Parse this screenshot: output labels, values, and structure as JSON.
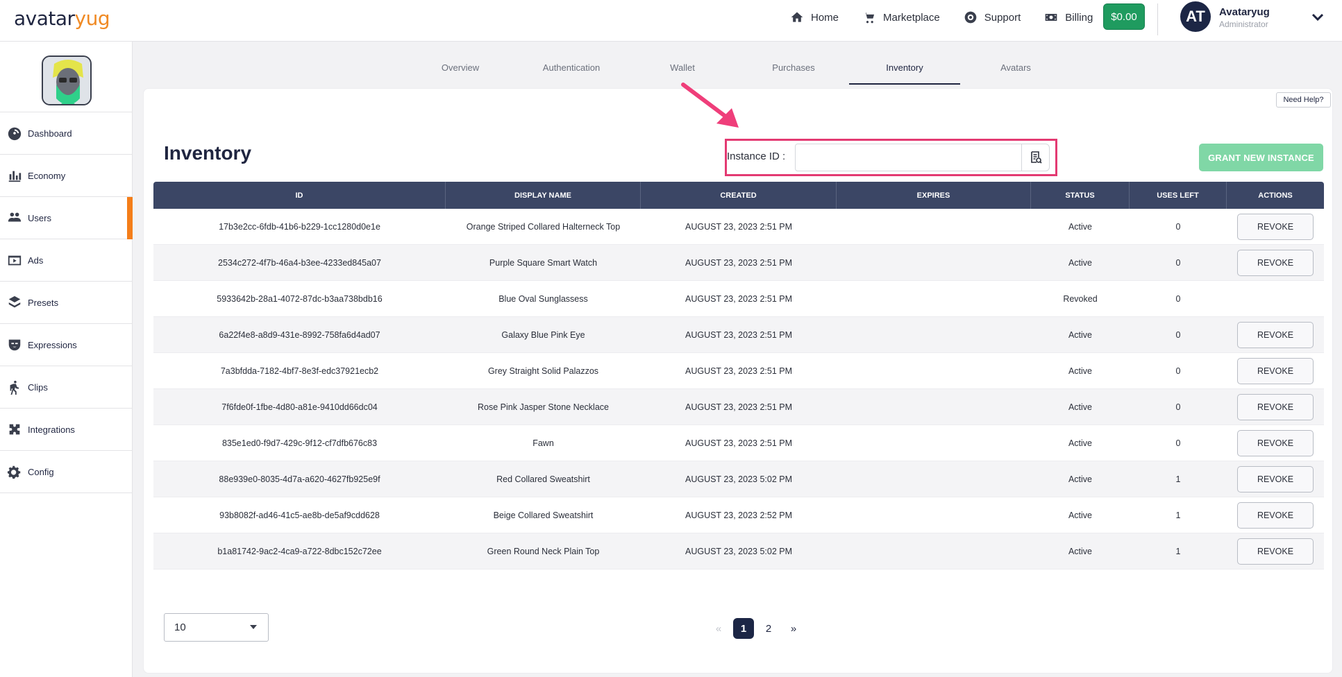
{
  "brand": {
    "logo_part1": "avatar",
    "logo_part2": "yug"
  },
  "nav": {
    "links": [
      {
        "label": "Home",
        "icon": "home-icon"
      },
      {
        "label": "Marketplace",
        "icon": "cart-icon"
      },
      {
        "label": "Support",
        "icon": "lifebuoy-icon"
      },
      {
        "label": "Billing",
        "icon": "money-icon"
      }
    ],
    "balance": "$0.00",
    "user": {
      "initials": "AT",
      "name": "Avataryug",
      "role": "Administrator"
    }
  },
  "sidebar": {
    "items": [
      {
        "label": "Dashboard",
        "icon": "gauge-icon"
      },
      {
        "label": "Economy",
        "icon": "bar-chart-icon"
      },
      {
        "label": "Users",
        "icon": "users-icon"
      },
      {
        "label": "Ads",
        "icon": "ads-icon"
      },
      {
        "label": "Presets",
        "icon": "presets-icon"
      },
      {
        "label": "Expressions",
        "icon": "mask-icon"
      },
      {
        "label": "Clips",
        "icon": "walking-icon"
      },
      {
        "label": "Integrations",
        "icon": "puzzle-icon"
      },
      {
        "label": "Config",
        "icon": "gears-icon"
      }
    ],
    "active": "Users"
  },
  "tabs": [
    "Overview",
    "Authentication",
    "Wallet",
    "Purchases",
    "Inventory",
    "Avatars"
  ],
  "active_tab": "Inventory",
  "page": {
    "title": "Inventory",
    "need_help": "Need Help?",
    "instance_label": "Instance ID :",
    "instance_value": "",
    "grant_button": "GRANT NEW INSTANCE"
  },
  "table": {
    "headers": [
      "ID",
      "DISPLAY NAME",
      "CREATED",
      "EXPIRES",
      "STATUS",
      "USES LEFT",
      "ACTIONS"
    ],
    "action_label": "REVOKE",
    "rows": [
      {
        "id": "17b3e2cc-6fdb-41b6-b229-1cc1280d0e1e",
        "name": "Orange Striped Collared Halterneck Top",
        "created": "AUGUST 23, 2023 2:51 PM",
        "expires": "",
        "status": "Active",
        "uses": "0",
        "revokable": true
      },
      {
        "id": "2534c272-4f7b-46a4-b3ee-4233ed845a07",
        "name": "Purple Square Smart Watch",
        "created": "AUGUST 23, 2023 2:51 PM",
        "expires": "",
        "status": "Active",
        "uses": "0",
        "revokable": true
      },
      {
        "id": "5933642b-28a1-4072-87dc-b3aa738bdb16",
        "name": "Blue Oval Sunglassess",
        "created": "AUGUST 23, 2023 2:51 PM",
        "expires": "",
        "status": "Revoked",
        "uses": "0",
        "revokable": false
      },
      {
        "id": "6a22f4e8-a8d9-431e-8992-758fa6d4ad07",
        "name": "Galaxy Blue Pink Eye",
        "created": "AUGUST 23, 2023 2:51 PM",
        "expires": "",
        "status": "Active",
        "uses": "0",
        "revokable": true
      },
      {
        "id": "7a3bfdda-7182-4bf7-8e3f-edc37921ecb2",
        "name": "Grey Straight Solid Palazzos",
        "created": "AUGUST 23, 2023 2:51 PM",
        "expires": "",
        "status": "Active",
        "uses": "0",
        "revokable": true
      },
      {
        "id": "7f6fde0f-1fbe-4d80-a81e-9410dd66dc04",
        "name": "Rose Pink Jasper Stone Necklace",
        "created": "AUGUST 23, 2023 2:51 PM",
        "expires": "",
        "status": "Active",
        "uses": "0",
        "revokable": true
      },
      {
        "id": "835e1ed0-f9d7-429c-9f12-cf7dfb676c83",
        "name": "Fawn",
        "created": "AUGUST 23, 2023 2:51 PM",
        "expires": "",
        "status": "Active",
        "uses": "0",
        "revokable": true
      },
      {
        "id": "88e939e0-8035-4d7a-a620-4627fb925e9f",
        "name": "Red Collared Sweatshirt",
        "created": "AUGUST 23, 2023 5:02 PM",
        "expires": "",
        "status": "Active",
        "uses": "1",
        "revokable": true
      },
      {
        "id": "93b8082f-ad46-41c5-ae8b-de5af9cdd628",
        "name": "Beige Collared Sweatshirt",
        "created": "AUGUST 23, 2023 2:52 PM",
        "expires": "",
        "status": "Active",
        "uses": "1",
        "revokable": true
      },
      {
        "id": "b1a81742-9ac2-4ca9-a722-8dbc152c72ee",
        "name": "Green Round Neck Plain Top",
        "created": "AUGUST 23, 2023 5:02 PM",
        "expires": "",
        "status": "Active",
        "uses": "1",
        "revokable": true
      }
    ]
  },
  "pagination": {
    "page_size": "10",
    "prev": "«",
    "pages": [
      "1",
      "2"
    ],
    "current": "1",
    "next": "»"
  },
  "colors": {
    "accent_orange": "#f47e1a",
    "header_navy": "#3b4665",
    "highlight_pink": "#e33a72",
    "wallet_green": "#1f9b5f",
    "grant_green": "#80d7a6"
  }
}
